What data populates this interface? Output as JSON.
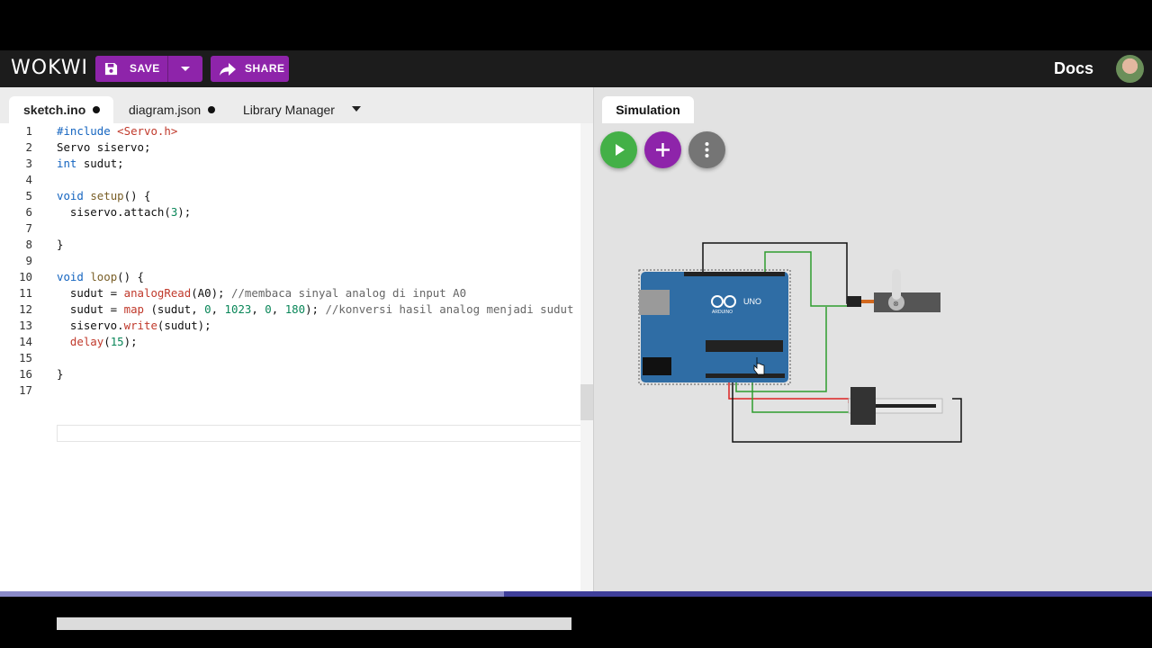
{
  "app": {
    "logo": "WOKWI",
    "docs_link": "Docs"
  },
  "toolbar": {
    "save_label": "SAVE",
    "share_label": "SHARE"
  },
  "tabs": [
    {
      "label": "sketch.ino",
      "modified": true,
      "active": true
    },
    {
      "label": "diagram.json",
      "modified": true,
      "active": false
    },
    {
      "label": "Library Manager",
      "active": false
    }
  ],
  "code": {
    "lines": [
      "#include <Servo.h>",
      "Servo siservo;",
      "int sudut;",
      "",
      "void setup() {",
      "  siservo.attach(3);",
      "",
      "}",
      "",
      "void loop() {",
      "  sudut = analogRead(A0); //membaca sinyal analog di input A0",
      "  sudut = map (sudut, 0, 1023, 0, 180); //konversi hasil analog menjadi sudut",
      "  siservo.write(sudut);",
      "  delay(15);",
      "",
      "}",
      ""
    ]
  },
  "simulation": {
    "tab_label": "Simulation",
    "buttons": [
      "play-icon",
      "plus-icon",
      "more-vertical-icon"
    ],
    "board_label": "UNO",
    "board_brand": "ARDUINO",
    "colors": {
      "play": "#43b047",
      "add": "#8e24aa",
      "more": "#757575",
      "board": "#2f6da5"
    }
  }
}
